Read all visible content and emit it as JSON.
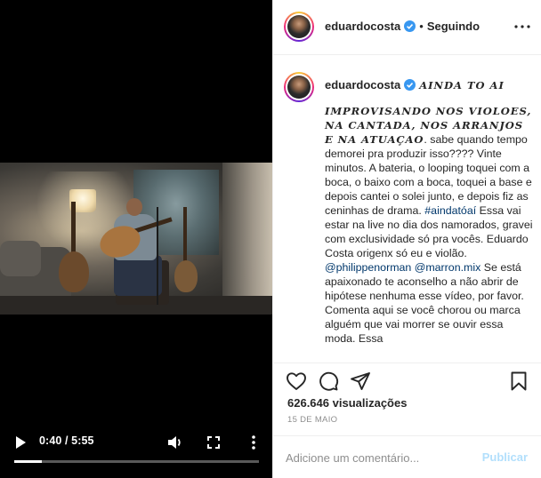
{
  "video": {
    "time_display": "0:40 / 5:55",
    "progress_fraction": 0.113
  },
  "header": {
    "username": "eduardocosta",
    "separator": "•",
    "follow_status": "Seguindo"
  },
  "caption": {
    "username": "eduardocosta",
    "title": "AINDA TO AI",
    "emphasis": "IMPROVISANDO NOS VIOLOES, NA CANTADA, NOS ARRANJOS E NA ATUAÇAO",
    "text1": ". sabe quando tempo demorei pra produzir isso???? Vinte minutos. A bateria, o looping toquei com a boca, o baixo com a boca, toquei a base e depois cantei o solei junto, e depois fiz as ceninhas de drama. ",
    "hashtag": "#aindatóaí",
    "text2": " Essa vai estar na live no dia dos namorados, gravei com exclusividade só pra vocês. Eduardo Costa origenx só eu e violão. ",
    "mention1": "@philippenorman",
    "mention2": "@marron.mix",
    "text3": " Se está apaixonado te aconselho a não abrir de hipótese nenhuma esse vídeo, por favor. Comenta aqui se você chorou ou marca alguém que vai morrer se ouvir essa moda. Essa"
  },
  "stats": {
    "views_number": "626.646",
    "views_label": "visualizações",
    "date": "15 DE MAIO"
  },
  "comment": {
    "placeholder": "Adicione um comentário...",
    "publish_label": "Publicar"
  },
  "colors": {
    "accent_blue": "#0095f6",
    "link": "#00376b",
    "muted": "#8e8e8e",
    "publish_disabled": "#b2dffc"
  }
}
